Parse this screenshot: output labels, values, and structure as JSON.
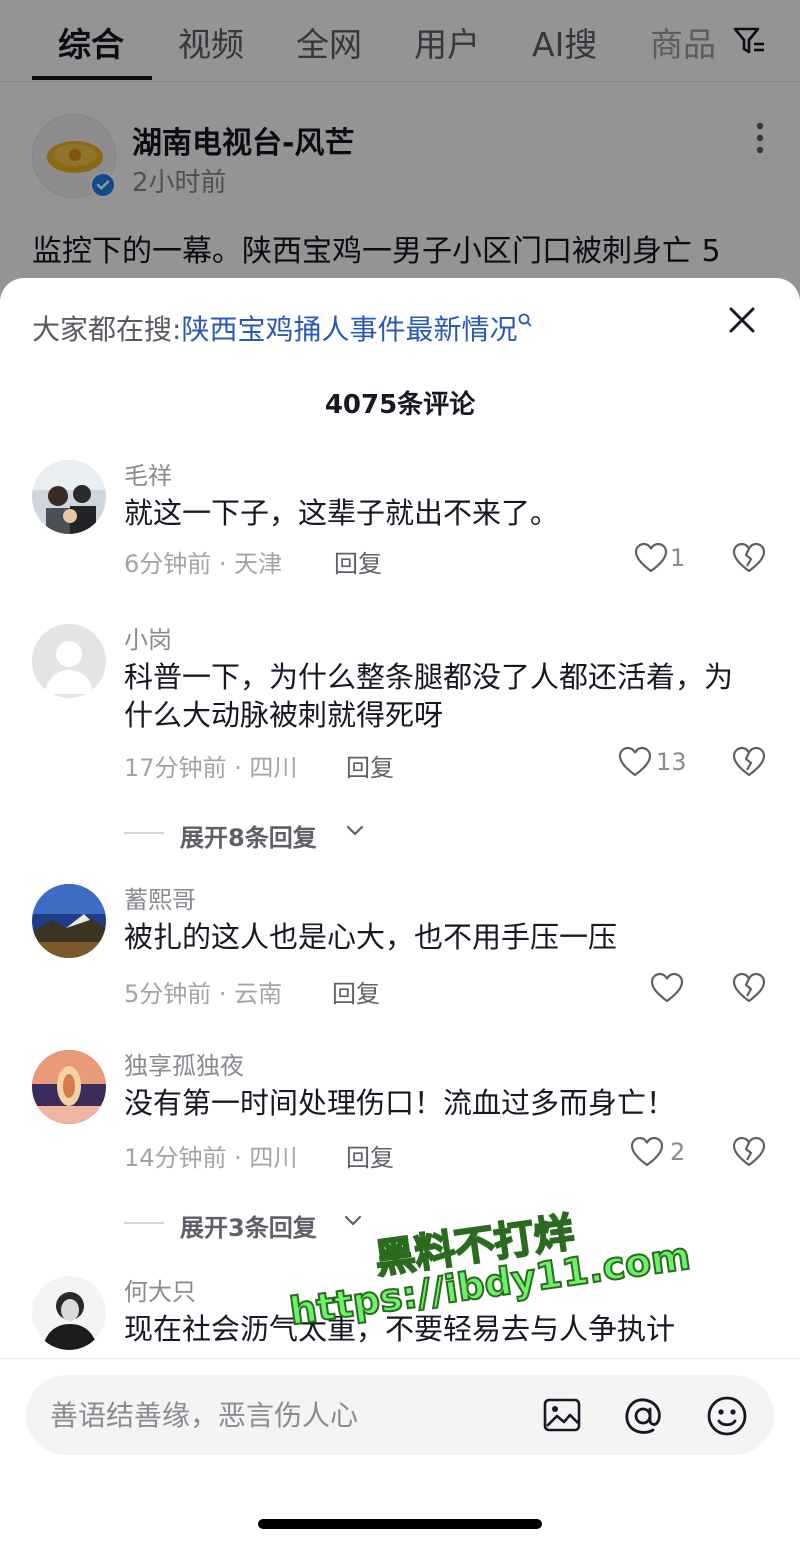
{
  "tabs": [
    {
      "label": "综合"
    },
    {
      "label": "视频"
    },
    {
      "label": "全网"
    },
    {
      "label": "用户"
    },
    {
      "label": "AI搜"
    },
    {
      "label": "商品"
    }
  ],
  "post": {
    "author": "湖南电视台-风芒",
    "time": "2小时前",
    "text": "监控下的一幕。陕西宝鸡一男子小区门口被刺身亡 5"
  },
  "sheet": {
    "search_prefix": "大家都在搜:",
    "search_query": "陕西宝鸡捅人事件最新情况",
    "comment_count": "4075条评论"
  },
  "comments": [
    {
      "name": "毛祥",
      "text": "就这一下子，这辈子就出不来了。",
      "meta": "6分钟前 · 天津",
      "reply": "回复",
      "likes": "1"
    },
    {
      "name": "小岗",
      "text": "科普一下，为什么整条腿都没了人都还活着，为什么大动脉被刺就得死呀",
      "meta": "17分钟前 · 四川",
      "reply": "回复",
      "likes": "13"
    },
    {
      "name": "蓄熙哥",
      "text": "被扎的这人也是心大，也不用手压一压",
      "meta": "5分钟前 · 云南",
      "reply": "回复",
      "likes": ""
    },
    {
      "name": "独享孤独夜",
      "text": "没有第一时间处理伤口！流血过多而身亡！",
      "meta": "14分钟前 · 四川",
      "reply": "回复",
      "likes": "2"
    },
    {
      "name": "何大只",
      "text": "现在社会沥气太重，不要轻易去与人争执计"
    }
  ],
  "expand": [
    {
      "label": "展开8条回复"
    },
    {
      "label": "展开3条回复"
    }
  ],
  "watermark": {
    "line1": "黑料不打烊",
    "line2": "https://ibdy11.com"
  },
  "input": {
    "placeholder": "善语结善缘，恶言伤人心"
  },
  "colors": {
    "accent_link": "#2a5ab3",
    "verified_badge": "#1f82f0",
    "watermark": "#6ff06a"
  },
  "icons": [
    "filter-icon",
    "more-icon",
    "search-icon",
    "close-icon",
    "heart-icon",
    "broken-heart-icon",
    "chevron-down-icon",
    "image-icon",
    "at-icon",
    "emoji-icon"
  ]
}
